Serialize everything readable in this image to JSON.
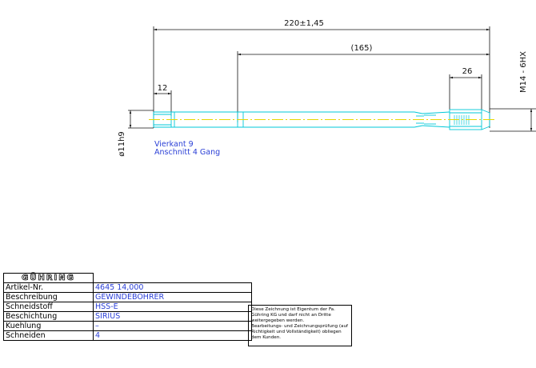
{
  "dimensions": {
    "overall_length": "220±1,45",
    "shank_length": "(165)",
    "square_length": "12",
    "thread_length": "26",
    "shank_diameter": "ø11h9",
    "thread_spec": "M14 - 6HX"
  },
  "notes": {
    "line1": "Vierkant 9",
    "line2": "Anschnitt 4 Gang"
  },
  "title_block": {
    "logo": "GÜHRING",
    "rows": [
      {
        "label": "Artikel-Nr.",
        "value": "4645 14,000"
      },
      {
        "label": "Beschreibung",
        "value": "GEWINDEBOHRER"
      },
      {
        "label": "Schneidstoff",
        "value": "HSS-E"
      },
      {
        "label": "Beschichtung",
        "value": "SIRIUS"
      },
      {
        "label": "Kuehlung",
        "value": "–"
      },
      {
        "label": "Schneiden",
        "value": "4"
      }
    ]
  },
  "disclaimer": {
    "p1": "Diese Zeichnung ist Eigentum der Fa. Gühring KG und darf nicht an Dritte weitergegeben werden.",
    "p2": "Bearbeitungs- und Zeichnungsprüfung (auf Richtigkeit und Vollständigkeit) obliegen dem Kunden."
  },
  "colors": {
    "outline": "#00c8d8",
    "centerline": "#e6d800",
    "dimension": "#111111",
    "note_text": "#2a3fd6"
  }
}
